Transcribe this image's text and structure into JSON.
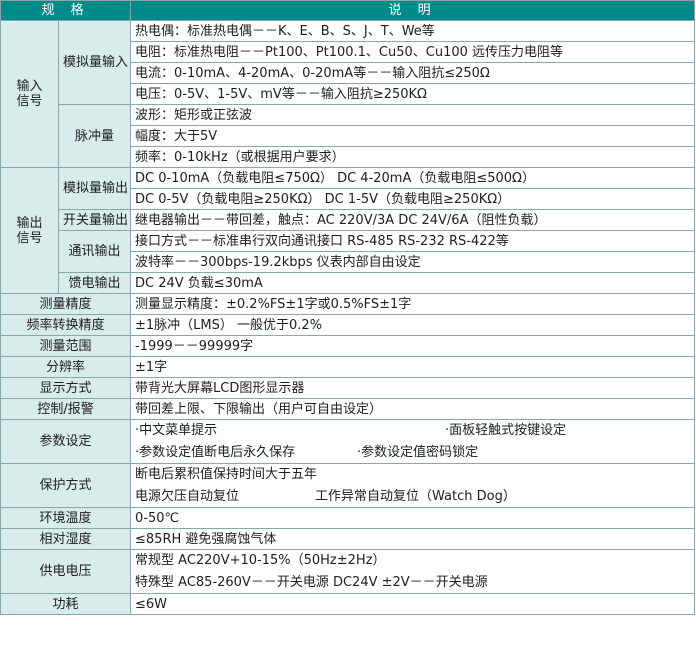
{
  "header": {
    "spec": "规  格",
    "desc": "说      明"
  },
  "input": {
    "label": "输入信号",
    "analog_label": "模拟量输入",
    "analog": [
      "热电偶：标准热电偶－－K、E、B、S、J、T、We等",
      "电阻：标准热电阻－－Pt100、Pt100.1、Cu50、Cu100 远传压力电阻等",
      "电流：0-10mA、4-20mA、0-20mA等－－输入阻抗≤250Ω",
      "电压：0-5V、1-5V、mV等－－输入阻抗≥250KΩ"
    ],
    "pulse_label": "脉冲量",
    "pulse": [
      "波形：矩形或正弦波",
      "幅度：大于5V",
      "频率：0-10kHz（或根据用户要求）"
    ]
  },
  "output": {
    "label": "输出信号",
    "analog_label": "模拟量输出",
    "analog": [
      "DC 0-10mA（负载电阻≤750Ω） DC 4-20mA（负载电阻≤500Ω）",
      "DC 0-5V（负载电阻≥250KΩ）  DC 1-5V（负载电阻≥250KΩ）"
    ],
    "switch_label": "开关量输出",
    "switch": "继电器输出－－带回差，触点：AC 220V/3A  DC 24V/6A（阻性负载）",
    "comm_label": "通讯输出",
    "comm": [
      "接口方式－－标准串行双向通讯接口 RS-485 RS-232 RS-422等",
      "波特率－－300bps-19.2kbps 仪表内部自由设定"
    ],
    "feed_label": "馈电输出",
    "feed": "DC 24V  负载≤30mA"
  },
  "rows": {
    "precision_label": "测量精度",
    "precision": "测量显示精度：±0.2%FS±1字或0.5%FS±1字",
    "freq_label": "频率转换精度",
    "freq": "±1脉冲（LMS） 一般优于0.2%",
    "range_label": "测量范围",
    "range": "-1999－－99999字",
    "resolution_label": "分辨率",
    "resolution": "±1字",
    "display_label": "显示方式",
    "display": "带背光大屏幕LCD图形显示器",
    "control_label": "控制/报警",
    "control": "带回差上限、下限输出（用户可自由设定）",
    "param_label": "参数设定",
    "param": [
      "·中文菜单提示",
      "·面板轻触式按键设定",
      "·参数设定值断电后永久保存",
      "·参数设定值密码锁定"
    ],
    "protect_label": "保护方式",
    "protect": [
      "断电后累积值保持时间大于五年",
      "电源欠压自动复位",
      "工作异常自动复位（Watch Dog）"
    ],
    "temp_label": "环境温度",
    "temp": "0-50℃",
    "humid_label": "相对湿度",
    "humid": "≤85RH      避免强腐蚀气体",
    "power_label": "供电电压",
    "power": [
      "常规型  AC220V+10-15%（50Hz±2Hz）",
      "特殊型  AC85-260V－－开关电源  DC24V ±2V－－开关电源"
    ],
    "consume_label": "功耗",
    "consume": "≤6W"
  }
}
